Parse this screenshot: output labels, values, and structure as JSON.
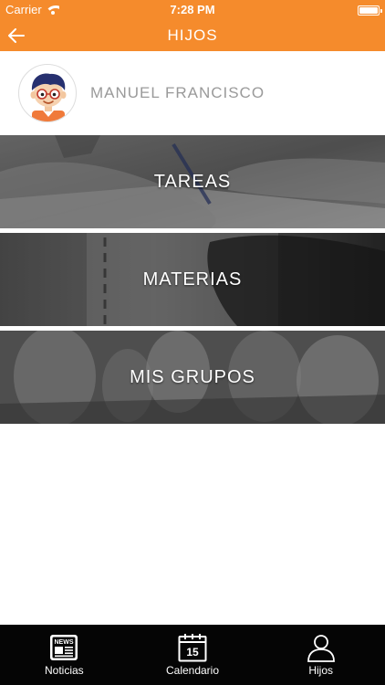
{
  "status_bar": {
    "carrier": "Carrier",
    "time": "7:28 PM"
  },
  "nav": {
    "title": "HIJOS",
    "back_icon": "arrow-left-icon"
  },
  "child": {
    "name": "MANUEL FRANCISCO",
    "avatar_icon": "boy-avatar-icon"
  },
  "menu": [
    {
      "label": "TAREAS"
    },
    {
      "label": "MATERIAS"
    },
    {
      "label": "MIS GRUPOS"
    }
  ],
  "tabs": [
    {
      "label": "Noticias",
      "icon": "news-icon",
      "icon_text": "NEWS"
    },
    {
      "label": "Calendario",
      "icon": "calendar-icon",
      "icon_text": "15"
    },
    {
      "label": "Hijos",
      "icon": "person-icon"
    }
  ],
  "colors": {
    "header": "#f58b2c",
    "tabbar": "#050505",
    "name_text": "#9a9a9a"
  }
}
